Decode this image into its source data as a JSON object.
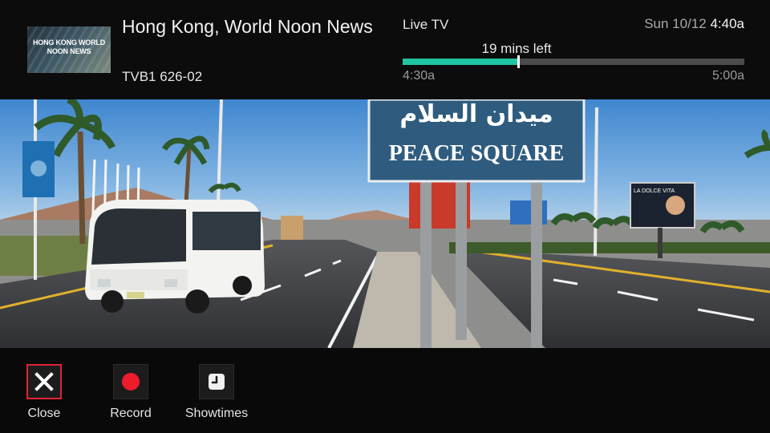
{
  "program": {
    "thumbnail_text": "HONG KONG WORLD NOON NEWS",
    "title": "Hong Kong, World Noon News",
    "channel": "TVB1 626-02"
  },
  "live": {
    "label": "Live TV",
    "remaining": "19 mins left",
    "start_time": "4:30a",
    "end_time": "5:00a",
    "progress": 0.337
  },
  "clock": {
    "date": "Sun 10/12",
    "time": "4:40a"
  },
  "video": {
    "sign_arabic": "ميدان السلام",
    "sign_english": "PEACE SQUARE",
    "billboard_text": "LA DOLCE VITA"
  },
  "actions": [
    {
      "label": "Close",
      "icon": "close-icon",
      "selected": true
    },
    {
      "label": "Record",
      "icon": "record-icon",
      "selected": false
    },
    {
      "label": "Showtimes",
      "icon": "clock-icon",
      "selected": false
    }
  ],
  "colors": {
    "progress_fill": "#20c5a2",
    "selection": "#e02434",
    "record": "#ec1c2c"
  }
}
